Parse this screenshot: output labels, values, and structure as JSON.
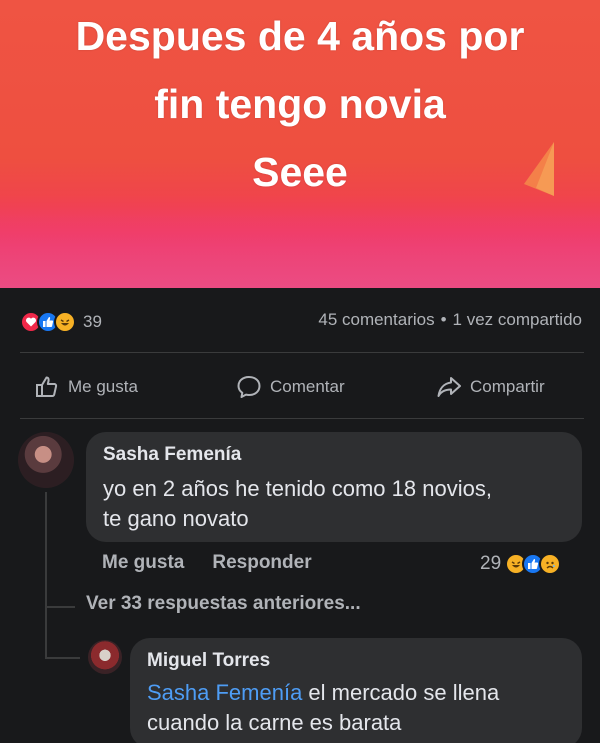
{
  "post": {
    "text_lines": [
      "Despues de 4 años por",
      "fin tengo novia",
      "Seee"
    ],
    "colors": {
      "background_top": "#ef5443",
      "background_bottom": "#ea4d84"
    }
  },
  "stats": {
    "reactions": [
      "love-icon",
      "like-icon",
      "haha-icon"
    ],
    "reaction_count": "39",
    "comments": "45 comentarios",
    "separator": "•",
    "shares": "1 vez compartido"
  },
  "actions": {
    "like": "Me gusta",
    "comment": "Comentar",
    "share": "Compartir"
  },
  "comments": [
    {
      "author": "Sasha Femenía",
      "text_lines": [
        "yo en 2 años he tenido como 18 novios,",
        "te gano novato"
      ],
      "like_label": "Me gusta",
      "reply_label": "Responder",
      "reaction_count": "29",
      "reactions": [
        "haha-icon",
        "like-icon",
        "sad-icon"
      ]
    }
  ],
  "replies_link": "Ver 33 respuestas anteriores...",
  "reply": {
    "author": "Miguel Torres",
    "mention": "Sasha Femenía",
    "text_rest": " el mercado se llena",
    "text_line2": "cuando la carne es barata"
  },
  "colors": {
    "background": "#18191b",
    "bubble": "#2e2f31",
    "mention": "#4e9df5",
    "muted": "#b0b3b8"
  }
}
